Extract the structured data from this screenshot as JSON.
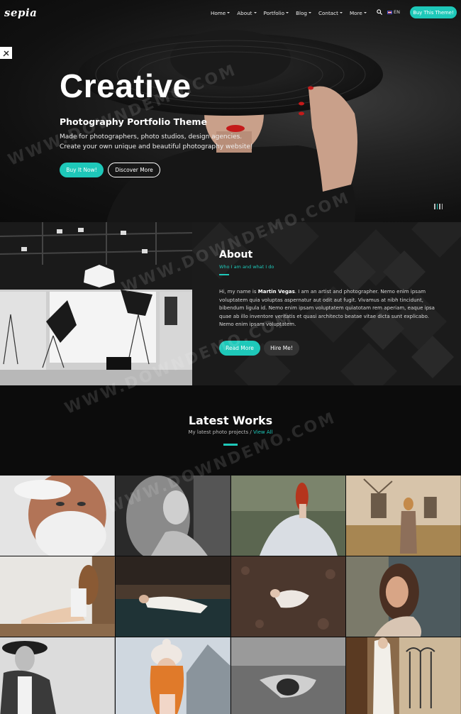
{
  "nav": {
    "logo": "sepia",
    "items": [
      {
        "label": "Home"
      },
      {
        "label": "About"
      },
      {
        "label": "Portfolio"
      },
      {
        "label": "Blog"
      },
      {
        "label": "Contact"
      },
      {
        "label": "More"
      }
    ],
    "lang": "EN",
    "buy_label": "Buy This Theme!"
  },
  "hero": {
    "title": "Creative",
    "subtitle": "Photography Portfolio Theme",
    "desc_line1": "Made for photographers, photo studios, design agencies.",
    "desc_line2": "Create your own unique and beautiful photography website!",
    "buy_label": "Buy It Now!",
    "discover_label": "Discover More"
  },
  "about": {
    "title": "About",
    "subtitle": "Who I am and what I do",
    "text_pre": "Hi, my name is ",
    "name": "Martin Vegas",
    "text_post": ". I am an artist and photographer. Nemo enim ipsam voluptatem quia voluptas aspernatur aut odit aut fugit. Vivamus at nibh tincidunt, bibendum ligula id. Nemo enim ipsam voluptatem quiatotam rem aperiam, eaque ipsa quae ab illo inventore veritatis et quasi architecto beatae vitae dicta sunt explicabo. Nemo enim ipsam voluptatem.",
    "read_more_label": "Read More",
    "hire_label": "Hire Me!"
  },
  "works": {
    "title": "Latest Works",
    "subtitle": "My latest photo projects",
    "separator": " / ",
    "view_all": "View All"
  },
  "watermark": "WWW.DOWNDEMO.COM",
  "colors": {
    "accent": "#1ec8b9",
    "background": "#0b0b0b"
  }
}
